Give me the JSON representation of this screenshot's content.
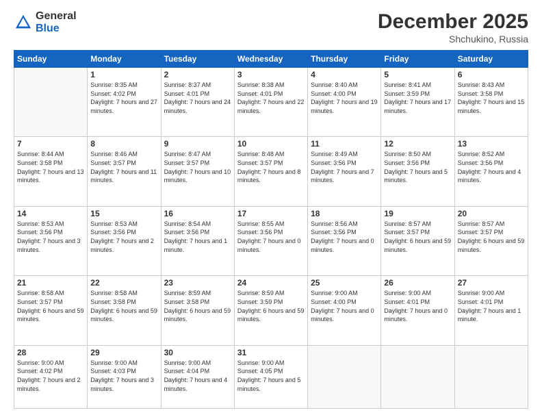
{
  "logo": {
    "general": "General",
    "blue": "Blue"
  },
  "title": "December 2025",
  "location": "Shchukino, Russia",
  "headers": [
    "Sunday",
    "Monday",
    "Tuesday",
    "Wednesday",
    "Thursday",
    "Friday",
    "Saturday"
  ],
  "weeks": [
    [
      {
        "day": "",
        "sunrise": "",
        "sunset": "",
        "daylight": ""
      },
      {
        "day": "1",
        "sunrise": "Sunrise: 8:35 AM",
        "sunset": "Sunset: 4:02 PM",
        "daylight": "Daylight: 7 hours and 27 minutes."
      },
      {
        "day": "2",
        "sunrise": "Sunrise: 8:37 AM",
        "sunset": "Sunset: 4:01 PM",
        "daylight": "Daylight: 7 hours and 24 minutes."
      },
      {
        "day": "3",
        "sunrise": "Sunrise: 8:38 AM",
        "sunset": "Sunset: 4:01 PM",
        "daylight": "Daylight: 7 hours and 22 minutes."
      },
      {
        "day": "4",
        "sunrise": "Sunrise: 8:40 AM",
        "sunset": "Sunset: 4:00 PM",
        "daylight": "Daylight: 7 hours and 19 minutes."
      },
      {
        "day": "5",
        "sunrise": "Sunrise: 8:41 AM",
        "sunset": "Sunset: 3:59 PM",
        "daylight": "Daylight: 7 hours and 17 minutes."
      },
      {
        "day": "6",
        "sunrise": "Sunrise: 8:43 AM",
        "sunset": "Sunset: 3:58 PM",
        "daylight": "Daylight: 7 hours and 15 minutes."
      }
    ],
    [
      {
        "day": "7",
        "sunrise": "Sunrise: 8:44 AM",
        "sunset": "Sunset: 3:58 PM",
        "daylight": "Daylight: 7 hours and 13 minutes."
      },
      {
        "day": "8",
        "sunrise": "Sunrise: 8:46 AM",
        "sunset": "Sunset: 3:57 PM",
        "daylight": "Daylight: 7 hours and 11 minutes."
      },
      {
        "day": "9",
        "sunrise": "Sunrise: 8:47 AM",
        "sunset": "Sunset: 3:57 PM",
        "daylight": "Daylight: 7 hours and 10 minutes."
      },
      {
        "day": "10",
        "sunrise": "Sunrise: 8:48 AM",
        "sunset": "Sunset: 3:57 PM",
        "daylight": "Daylight: 7 hours and 8 minutes."
      },
      {
        "day": "11",
        "sunrise": "Sunrise: 8:49 AM",
        "sunset": "Sunset: 3:56 PM",
        "daylight": "Daylight: 7 hours and 7 minutes."
      },
      {
        "day": "12",
        "sunrise": "Sunrise: 8:50 AM",
        "sunset": "Sunset: 3:56 PM",
        "daylight": "Daylight: 7 hours and 5 minutes."
      },
      {
        "day": "13",
        "sunrise": "Sunrise: 8:52 AM",
        "sunset": "Sunset: 3:56 PM",
        "daylight": "Daylight: 7 hours and 4 minutes."
      }
    ],
    [
      {
        "day": "14",
        "sunrise": "Sunrise: 8:53 AM",
        "sunset": "Sunset: 3:56 PM",
        "daylight": "Daylight: 7 hours and 3 minutes."
      },
      {
        "day": "15",
        "sunrise": "Sunrise: 8:53 AM",
        "sunset": "Sunset: 3:56 PM",
        "daylight": "Daylight: 7 hours and 2 minutes."
      },
      {
        "day": "16",
        "sunrise": "Sunrise: 8:54 AM",
        "sunset": "Sunset: 3:56 PM",
        "daylight": "Daylight: 7 hours and 1 minute."
      },
      {
        "day": "17",
        "sunrise": "Sunrise: 8:55 AM",
        "sunset": "Sunset: 3:56 PM",
        "daylight": "Daylight: 7 hours and 0 minutes."
      },
      {
        "day": "18",
        "sunrise": "Sunrise: 8:56 AM",
        "sunset": "Sunset: 3:56 PM",
        "daylight": "Daylight: 7 hours and 0 minutes."
      },
      {
        "day": "19",
        "sunrise": "Sunrise: 8:57 AM",
        "sunset": "Sunset: 3:57 PM",
        "daylight": "Daylight: 6 hours and 59 minutes."
      },
      {
        "day": "20",
        "sunrise": "Sunrise: 8:57 AM",
        "sunset": "Sunset: 3:57 PM",
        "daylight": "Daylight: 6 hours and 59 minutes."
      }
    ],
    [
      {
        "day": "21",
        "sunrise": "Sunrise: 8:58 AM",
        "sunset": "Sunset: 3:57 PM",
        "daylight": "Daylight: 6 hours and 59 minutes."
      },
      {
        "day": "22",
        "sunrise": "Sunrise: 8:58 AM",
        "sunset": "Sunset: 3:58 PM",
        "daylight": "Daylight: 6 hours and 59 minutes."
      },
      {
        "day": "23",
        "sunrise": "Sunrise: 8:59 AM",
        "sunset": "Sunset: 3:58 PM",
        "daylight": "Daylight: 6 hours and 59 minutes."
      },
      {
        "day": "24",
        "sunrise": "Sunrise: 8:59 AM",
        "sunset": "Sunset: 3:59 PM",
        "daylight": "Daylight: 6 hours and 59 minutes."
      },
      {
        "day": "25",
        "sunrise": "Sunrise: 9:00 AM",
        "sunset": "Sunset: 4:00 PM",
        "daylight": "Daylight: 7 hours and 0 minutes."
      },
      {
        "day": "26",
        "sunrise": "Sunrise: 9:00 AM",
        "sunset": "Sunset: 4:01 PM",
        "daylight": "Daylight: 7 hours and 0 minutes."
      },
      {
        "day": "27",
        "sunrise": "Sunrise: 9:00 AM",
        "sunset": "Sunset: 4:01 PM",
        "daylight": "Daylight: 7 hours and 1 minute."
      }
    ],
    [
      {
        "day": "28",
        "sunrise": "Sunrise: 9:00 AM",
        "sunset": "Sunset: 4:02 PM",
        "daylight": "Daylight: 7 hours and 2 minutes."
      },
      {
        "day": "29",
        "sunrise": "Sunrise: 9:00 AM",
        "sunset": "Sunset: 4:03 PM",
        "daylight": "Daylight: 7 hours and 3 minutes."
      },
      {
        "day": "30",
        "sunrise": "Sunrise: 9:00 AM",
        "sunset": "Sunset: 4:04 PM",
        "daylight": "Daylight: 7 hours and 4 minutes."
      },
      {
        "day": "31",
        "sunrise": "Sunrise: 9:00 AM",
        "sunset": "Sunset: 4:05 PM",
        "daylight": "Daylight: 7 hours and 5 minutes."
      },
      {
        "day": "",
        "sunrise": "",
        "sunset": "",
        "daylight": ""
      },
      {
        "day": "",
        "sunrise": "",
        "sunset": "",
        "daylight": ""
      },
      {
        "day": "",
        "sunrise": "",
        "sunset": "",
        "daylight": ""
      }
    ]
  ]
}
